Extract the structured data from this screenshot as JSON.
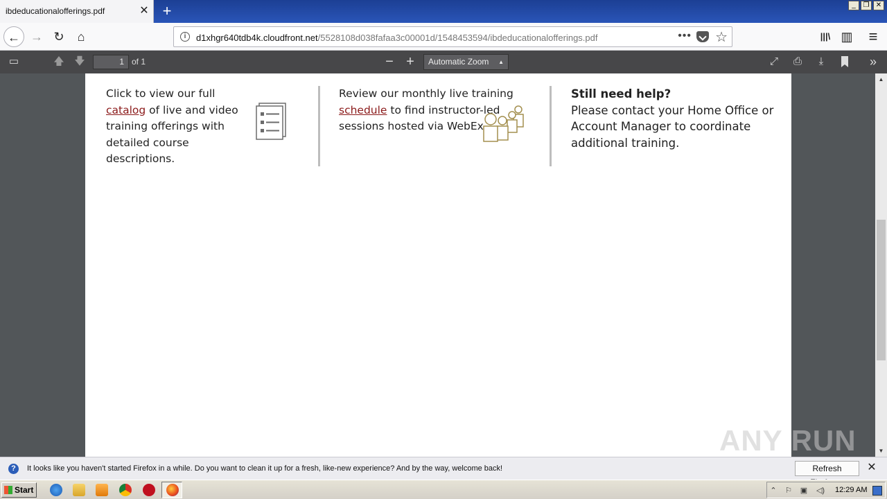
{
  "tab": {
    "title": "ibdeducationalofferings.pdf",
    "close": "✕",
    "new_tab": "+"
  },
  "window_controls": {
    "minimize": "_",
    "restore": "❐",
    "close": "✕"
  },
  "nav": {
    "back": "←",
    "forward": "→",
    "reload": "↻",
    "home": "⌂",
    "url_host": "d1xhgr640tdb4k.cloudfront.net",
    "url_path": "/5528108d038fafaa3c00001d/1548453594/ibdeducationalofferings.pdf",
    "more": "•••",
    "star": "☆",
    "library": "|||\\",
    "sidebar": "▥",
    "menu": "≡"
  },
  "pdf_toolbar": {
    "page_number": "1",
    "page_of": "of 1",
    "zoom_out": "−",
    "zoom_in": "+",
    "zoom_level": "Automatic Zoom",
    "icons": {
      "sidebar": "▭",
      "prev": "🡅",
      "next": "🡇",
      "presentation": "⤢",
      "print": "⎙",
      "download": "⤓",
      "bookmark": "🔖",
      "tools": "»"
    }
  },
  "document": {
    "col1": {
      "before_link": "Click to view our full ",
      "link": "catalog",
      "after_link": " of live and video training offerings with detailed course descriptions."
    },
    "col2": {
      "before_link": "Review our monthly live training ",
      "link": "schedule",
      "after_link": " to find instructor-led sessions hosted via WebEx."
    },
    "col3": {
      "title": "Still need help?",
      "body": "Please contact your Home Office or Account Manager to coordinate additional training."
    },
    "accent_color": "#8a7a3c",
    "link_color": "#8b1a1a"
  },
  "watermark": "ANY RUN",
  "notification": {
    "text": "It looks like you haven't started Firefox in a while. Do you want to clean it up for a fresh, like-new experience? And by the way, welcome back!",
    "button": "Refresh Firefox…",
    "close": "✕"
  },
  "taskbar": {
    "start": "Start",
    "clock": "12:29 AM"
  }
}
